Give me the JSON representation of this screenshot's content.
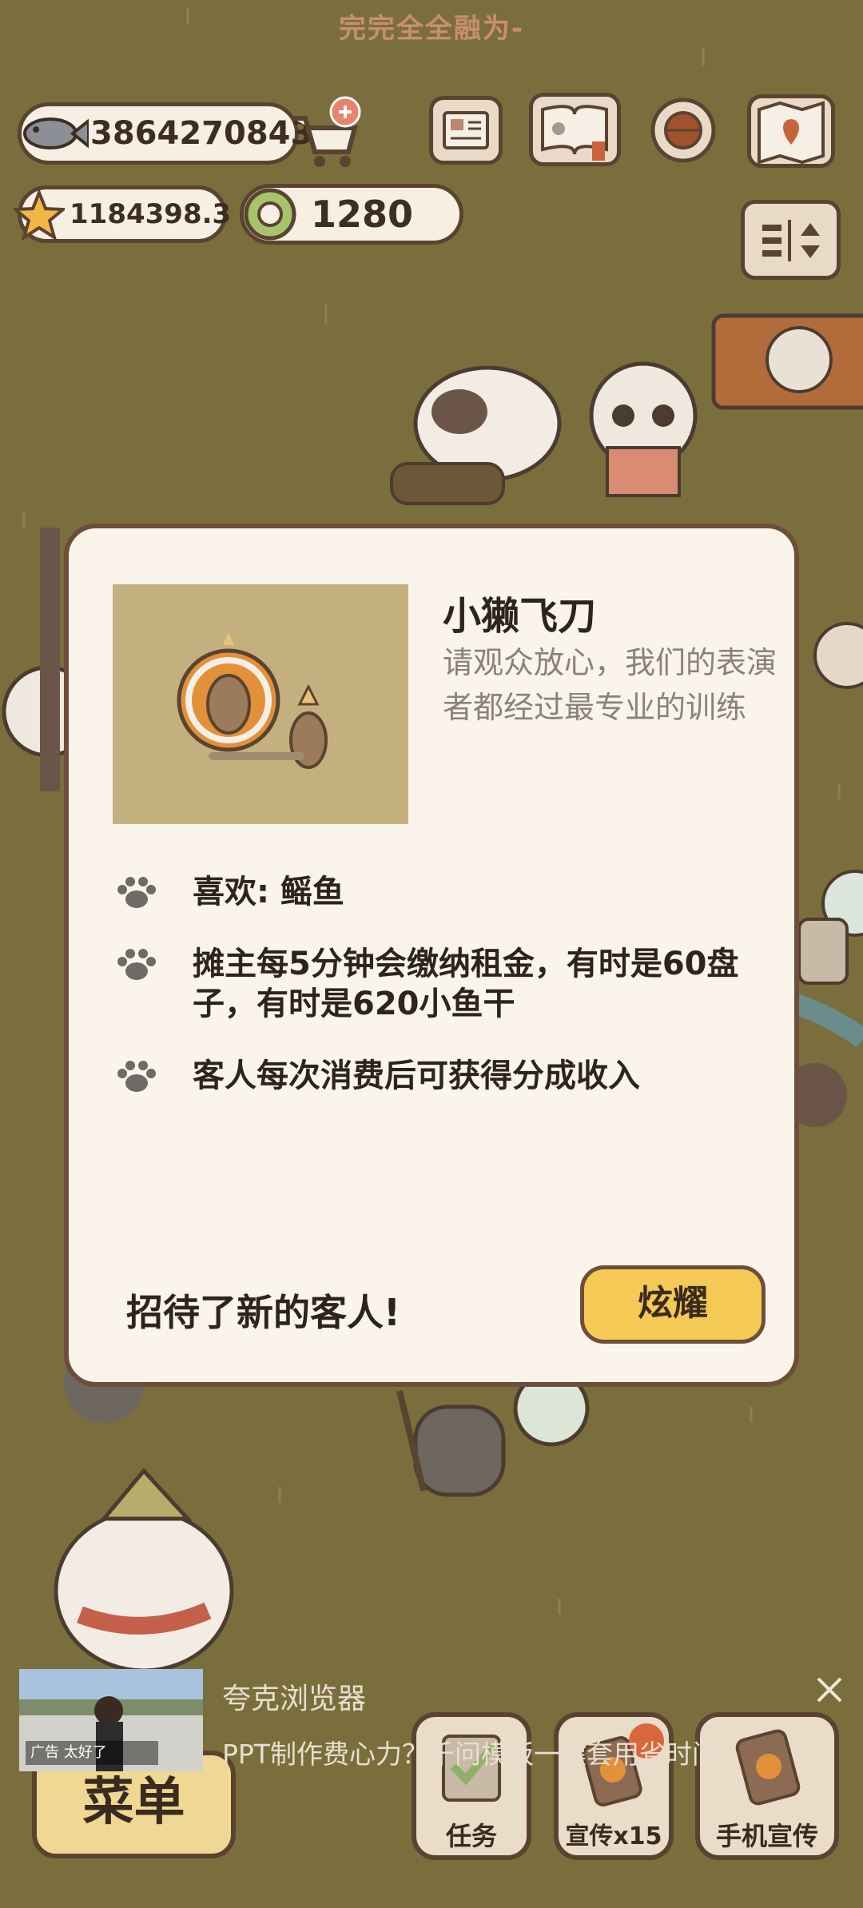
{
  "banner": {
    "text": "完完全全融为-"
  },
  "currency": {
    "fish": "3864270843",
    "stars": "1184398.3",
    "coins": "1280"
  },
  "modal": {
    "title": "小獭飞刀",
    "description": "请观众放心，我们的表演者都经过最专业的训练",
    "traits": [
      "喜欢: 鳐鱼",
      "摊主每5分钟会缴纳租金，有时是60盘子，有时是620小鱼干",
      "客人每次消费后可获得分成收入"
    ],
    "footer": "招待了新的客人!",
    "action": "炫耀"
  },
  "ad": {
    "app": "夸克浏览器",
    "text": "PPT制作费心力？千问模板一键套用省时间",
    "badge": "广告 太好了"
  },
  "bottom": {
    "menu": "菜单",
    "tasks": "任务",
    "promo": "宣传x15",
    "phone_promo": "手机宣传"
  },
  "colors": {
    "accent": "#f5c955",
    "border": "#6d4e3a",
    "panel": "#fbf4ea",
    "background": "#7b6e3d"
  }
}
